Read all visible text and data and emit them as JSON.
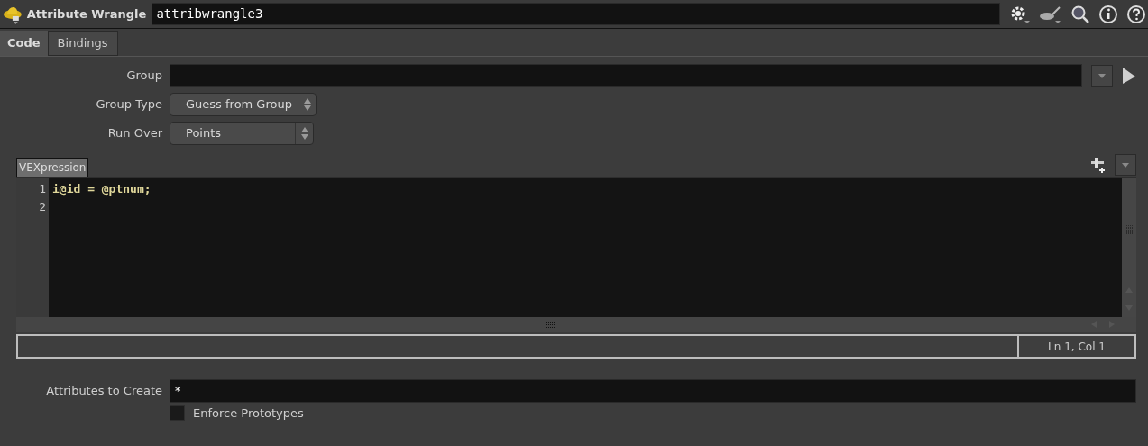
{
  "header": {
    "title": "Attribute Wrangle",
    "node_name": "attribwrangle3"
  },
  "tabs": [
    {
      "label": "Code",
      "selected": true
    },
    {
      "label": "Bindings",
      "selected": false
    }
  ],
  "group": {
    "label": "Group"
  },
  "group_type": {
    "label": "Group Type",
    "value": "Guess from Group"
  },
  "run_over": {
    "label": "Run Over",
    "value": "Points"
  },
  "editor": {
    "label": "VEXpression",
    "lines": [
      {
        "number": "1",
        "code": "i@id = @ptnum;"
      },
      {
        "number": "2"
      }
    ],
    "status": "Ln 1, Col 1"
  },
  "attributes_to_create": {
    "label": "Attributes to Create",
    "value": "*"
  },
  "enforce_prototypes": {
    "label": "Enforce Prototypes",
    "checked": false
  }
}
